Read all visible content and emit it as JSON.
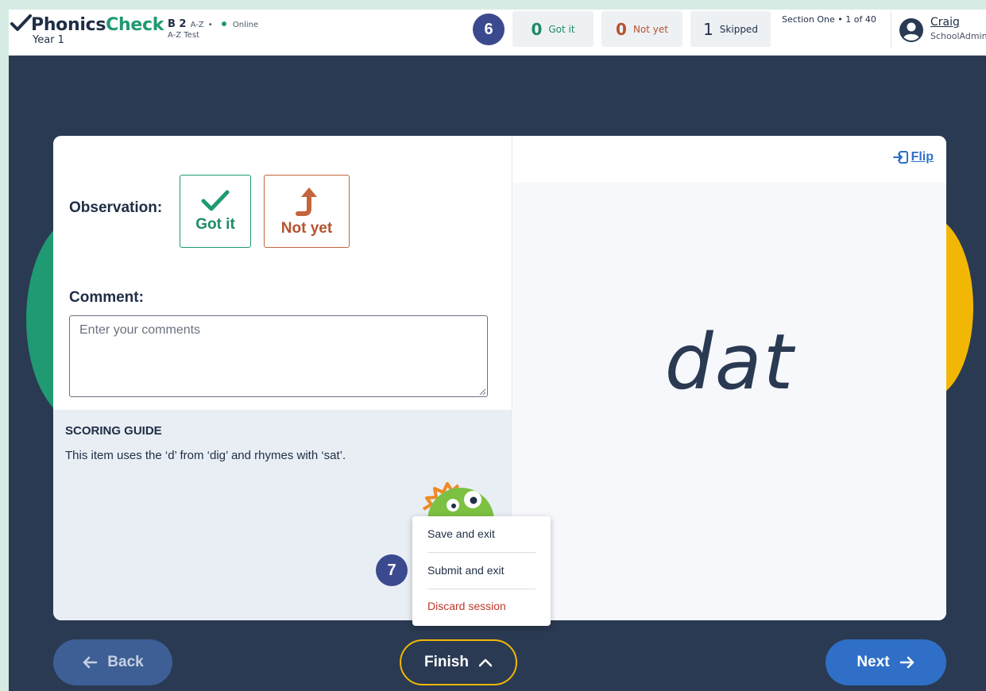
{
  "header": {
    "logo_part1": "Phonics",
    "logo_part2": "Check",
    "logo_year": "Year 1",
    "level": "B 2",
    "level_tag": "A-Z",
    "status": "Online",
    "test_name": "A-Z Test",
    "badge_step": "6",
    "stats": {
      "got_count": "0",
      "got_label": "Got it",
      "not_count": "0",
      "not_label": "Not yet",
      "skip_count": "1",
      "skip_label": "Skipped"
    },
    "section_info": "Section One • 1 of 40",
    "user_name": "Craig",
    "user_role": "SchoolAdmin"
  },
  "observation": {
    "label": "Observation:",
    "got_it": "Got it",
    "not_yet": "Not yet"
  },
  "comment": {
    "label": "Comment:",
    "placeholder": "Enter your comments",
    "value": ""
  },
  "scoring": {
    "title": "SCORING GUIDE",
    "text": "This item uses the ‘d’ from ‘dig’ and rhymes with ‘sat’."
  },
  "card": {
    "flip_label": "Flip",
    "word": "dat"
  },
  "menu": {
    "badge_step": "7",
    "save_exit": "Save and exit",
    "submit_exit": "Submit and exit",
    "discard": "Discard session"
  },
  "nav": {
    "back": "Back",
    "finish": "Finish",
    "next": "Next"
  },
  "colors": {
    "brand_green": "#1f9a72",
    "not_yet_orange": "#b5532f",
    "background_navy": "#2a3a52",
    "primary_blue": "#2f6fc7",
    "finish_outline": "#f2b705",
    "discard_red": "#c0392b"
  },
  "icons": {
    "logo": "checkmark-icon",
    "got_it": "checkmark-icon",
    "not_yet": "arrow-up-curved-icon",
    "flip": "flip-icon",
    "user": "user-avatar-icon",
    "back": "arrow-left-icon",
    "next": "arrow-right-icon",
    "finish": "chevron-up-icon"
  }
}
